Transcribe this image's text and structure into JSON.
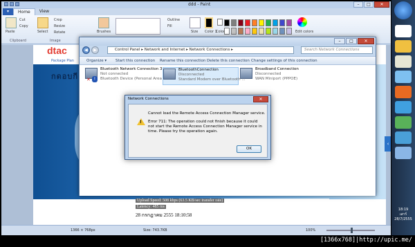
{
  "paint": {
    "title": "ddd - Paint",
    "tabs": [
      "Home",
      "View"
    ],
    "ribbon": {
      "paste": "Paste",
      "cut": "Cut",
      "copy": "Copy",
      "select": "Select",
      "crop": "Crop",
      "resize": "Resize",
      "rotate": "Rotate",
      "brushes": "Brushes",
      "outline": "Outline",
      "fill": "Fill",
      "size": "Size",
      "color1": "Color 1",
      "color2": "Color 2",
      "edit_colors": "Edit colors",
      "clipboard_group": "Clipboard",
      "image_group": "Image"
    },
    "palette": [
      "#000000",
      "#7f7f7f",
      "#880015",
      "#ed1c24",
      "#ff7f27",
      "#fff200",
      "#22b14c",
      "#00a2e8",
      "#3f48cc",
      "#a349a4",
      "#ffffff",
      "#c3c3c3",
      "#b97a57",
      "#ffaec9",
      "#ffc90e",
      "#efe4b0",
      "#b5e61d",
      "#99d9ea",
      "#7092be",
      "#c8bfe7"
    ],
    "status": {
      "dimensions": "1366 × 768px",
      "size": "Size: 743.7KB",
      "zoom": "100%"
    }
  },
  "webpage": {
    "logo": "dtac",
    "package_link": "Package Plan",
    "hero_text": "กดอบกี",
    "upload_speed": "Upload Speed: 508 kbps (63.5 KB/sec transfer rate)",
    "latency": "Latency: 485 ms",
    "timestamp": "28 กรกฎาคม 2555 18:10:58"
  },
  "network_window": {
    "breadcrumb": "Control Panel ▸ Network and Internet ▸ Network Connections ▸",
    "search_placeholder": "Search Network Connections",
    "commands": [
      "Organize ▾",
      "Start this connection",
      "Rename this connection",
      "Delete this connection",
      "Change settings of this connection"
    ],
    "connections": [
      {
        "name": "Bluetooth Network Connection 3",
        "status": "Not connected",
        "device": "Bluetooth Device (Personal Area ..."
      },
      {
        "name": "BluetoothConnection",
        "status": "Disconnected",
        "device": "Standard Modem over Bluetooth ..."
      },
      {
        "name": "Broadband Connection",
        "status": "Disconnected",
        "device": "WAN Miniport (PPPOE)"
      }
    ]
  },
  "error_dialog": {
    "title": "Network Connections",
    "message": "Cannot load the Remote Access Connection Manager service.",
    "detail": "Error 711: The operation could not finish because it could not start the Remote Access Connection Manager service in time. Please try the operation again.",
    "ok_label": "OK"
  },
  "taskbar": {
    "time": "18:19",
    "day": "เสาร์",
    "date": "28/7/2555"
  },
  "watermark": "[1366x768]|http://upic.me/"
}
